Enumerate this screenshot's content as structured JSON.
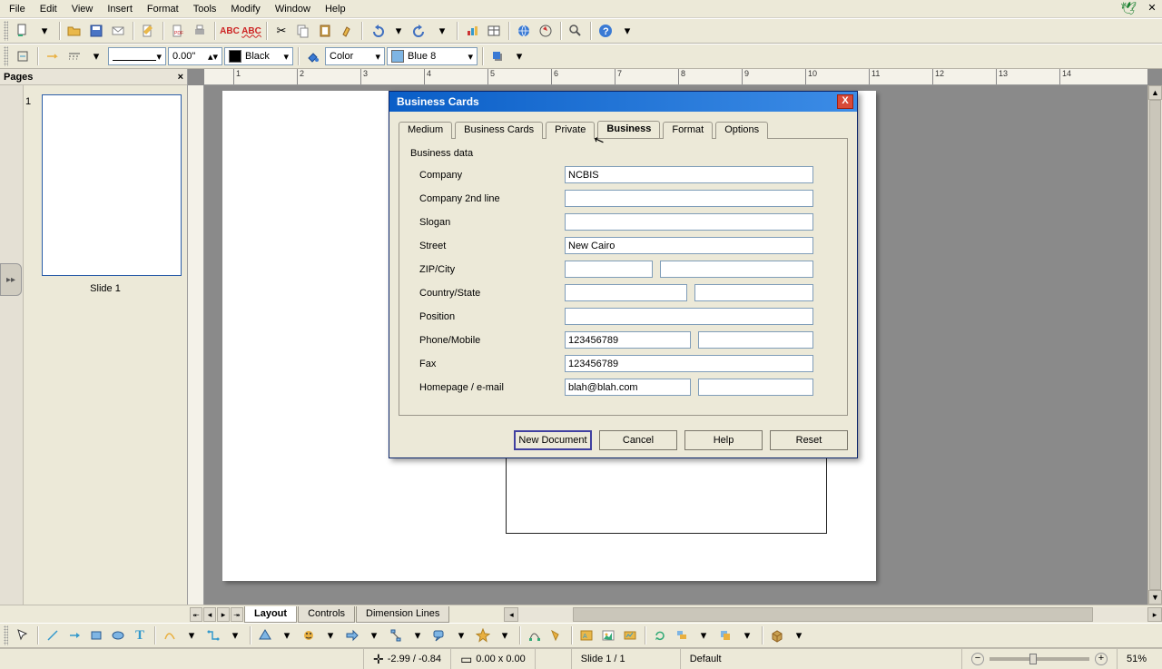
{
  "menubar": {
    "items": [
      "File",
      "Edit",
      "View",
      "Insert",
      "Format",
      "Tools",
      "Modify",
      "Window",
      "Help"
    ]
  },
  "toolbar2": {
    "width_label": "0.00\"",
    "color_name": "Black",
    "fill_mode": "Color",
    "fill_name": "Blue 8",
    "fill_swatch": "#7eb5e4",
    "black_swatch": "#000000"
  },
  "pages_pane": {
    "title": "Pages",
    "slide_caption": "Slide 1",
    "slide_num": "1"
  },
  "bottom": {
    "tabs": [
      "Layout",
      "Controls",
      "Dimension Lines"
    ]
  },
  "statusbar": {
    "cursor_pos": "-2.99 / -0.84",
    "obj_size": "0.00 x 0.00",
    "slide_info": "Slide 1 / 1",
    "style": "Default",
    "zoom": "51%"
  },
  "dialog": {
    "title": "Business Cards",
    "tabs": [
      "Medium",
      "Business Cards",
      "Private",
      "Business",
      "Format",
      "Options"
    ],
    "active_tab": "Business",
    "group_label": "Business data",
    "fields": {
      "company_label": "Company",
      "company": "NCBIS",
      "company2_label": "Company 2nd line",
      "company2": "",
      "slogan_label": "Slogan",
      "slogan": "",
      "street_label": "Street",
      "street": "New Cairo",
      "zipcity_label": "ZIP/City",
      "zip": "",
      "city": "",
      "countrystate_label": "Country/State",
      "country": "",
      "state": "",
      "position_label": "Position",
      "position": "",
      "phonemobile_label": "Phone/Mobile",
      "phone": "123456789",
      "mobile": "",
      "fax_label": "Fax",
      "fax": "123456789",
      "homepage_label": "Homepage / e-mail",
      "homepage": "blah@blah.com",
      "email": ""
    },
    "buttons": {
      "new_doc": "New Document",
      "cancel": "Cancel",
      "help": "Help",
      "reset": "Reset"
    }
  }
}
